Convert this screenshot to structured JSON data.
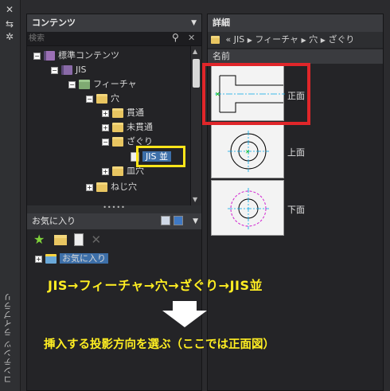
{
  "side": {
    "vertical_title": "コンテンツ ライブラリ",
    "close_icon": "close-icon",
    "pin_icon": "pin-icon",
    "settings_icon": "gear-icon"
  },
  "left_panel": {
    "title": "コンテンツ",
    "search_placeholder": "検索",
    "tree": [
      {
        "label": "標準コンテンツ",
        "icon": "book-stack-icon"
      },
      {
        "label": "JIS",
        "icon": "book-icon"
      },
      {
        "label": "フィーチャ",
        "icon": "feature-folder-icon"
      },
      {
        "label": "穴",
        "icon": "folder-icon"
      },
      {
        "label": "貫通",
        "icon": "folder-icon"
      },
      {
        "label": "未貫通",
        "icon": "folder-icon"
      },
      {
        "label": "ざぐり",
        "icon": "folder-icon"
      },
      {
        "label": "JIS 並",
        "icon": "document-icon",
        "selected": true
      },
      {
        "label": "皿穴",
        "icon": "folder-icon"
      },
      {
        "label": "ねじ穴",
        "icon": "folder-icon"
      }
    ],
    "splitter_dots": "•••••",
    "favorites_title": "お気に入り",
    "favorites_item": "お気に入り"
  },
  "right_panel": {
    "title": "詳細",
    "breadcrumb": [
      "JIS",
      "フィーチャ",
      "穴",
      "ざぐり"
    ],
    "breadcrumb_prefix": "«",
    "column_header": "名前",
    "views": [
      {
        "label": "正面"
      },
      {
        "label": "上面"
      },
      {
        "label": "下面"
      }
    ]
  },
  "annotations": {
    "line1": "JIS→フィーチャ→穴→ざぐり→JIS並",
    "line2": "挿入する投影方向を選ぶ（ここでは正面図）"
  },
  "colors": {
    "highlight_red": "#e0262a",
    "highlight_yellow": "#ffe51a",
    "text_yellow": "#ffee22",
    "selection_blue": "#3d6fa8"
  }
}
